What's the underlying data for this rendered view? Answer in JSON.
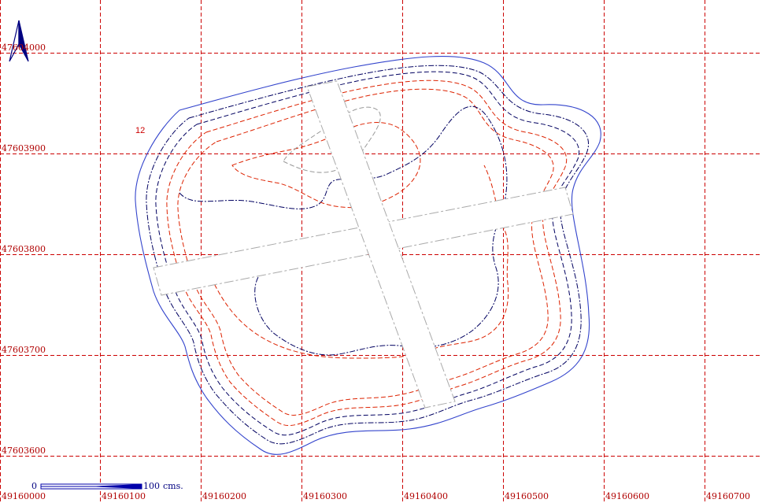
{
  "map": {
    "colors": {
      "grid": "#cc0000",
      "outline": "#3344cc",
      "contour_dark": "#000060",
      "contour_red": "#dd2200",
      "contour_gray": "#999999",
      "arrow": "#000080",
      "scale": "#0000aa"
    },
    "grid": {
      "x_labels": [
        "49160000",
        "49160100",
        "49160200",
        "49160300",
        "49160400",
        "49160500",
        "49160600",
        "49160700"
      ],
      "y_labels": [
        "47604000",
        "47603900",
        "47603800",
        "47603700",
        "47603600"
      ]
    },
    "scale_bar": {
      "start_label": "0",
      "end_label": "100",
      "unit": "cms."
    },
    "annotation": "12",
    "north_arrow": "north-arrow"
  }
}
